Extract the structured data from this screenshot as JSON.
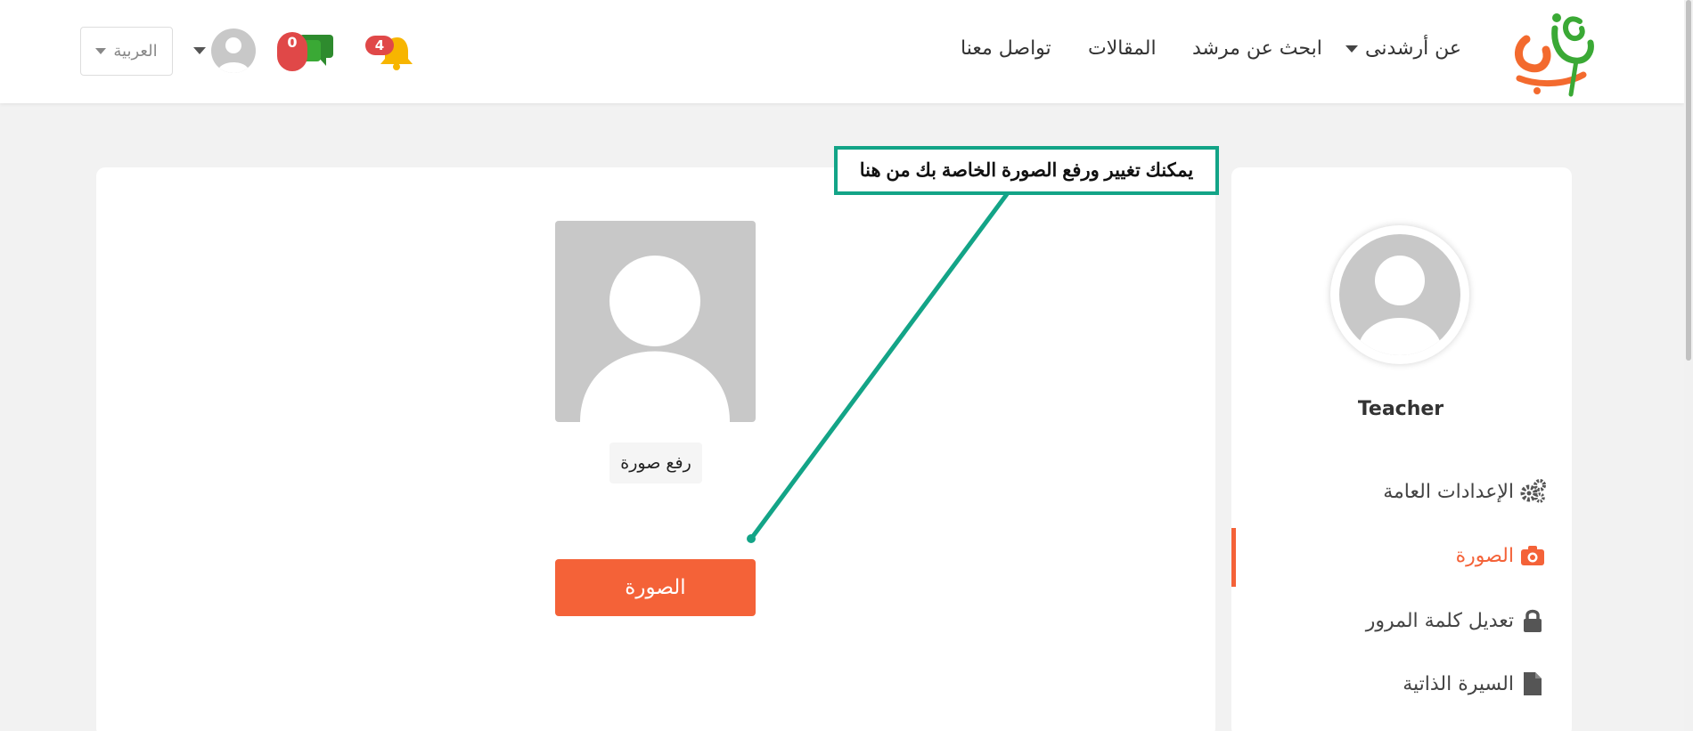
{
  "nav": {
    "links": [
      {
        "label": "عن أرشدنى"
      },
      {
        "label": "ابحث عن مرشد"
      },
      {
        "label": "المقالات"
      },
      {
        "label": "تواصل معنا"
      }
    ],
    "notifications_count": "4",
    "messages_count": "0",
    "language": "العربية"
  },
  "main": {
    "upload_label": "رفع صورة",
    "photo_button_label": "الصورة"
  },
  "profile": {
    "name": "Teacher",
    "menu": [
      {
        "label": "الإعدادات العامة",
        "icon": "gears-icon"
      },
      {
        "label": "الصورة",
        "icon": "camera-icon",
        "active": true
      },
      {
        "label": "تعديل كلمة المرور",
        "icon": "lock-icon"
      },
      {
        "label": "السيرة الذاتية",
        "icon": "file-icon"
      }
    ]
  },
  "annotation": {
    "text": "يمكنك تغيير ورفع الصورة الخاصة بك من هنا"
  },
  "colors": {
    "accent": "#f46238",
    "annotation": "#13a487",
    "logo_orange": "#f36a2e",
    "logo_green": "#3aa935",
    "badge_red": "#e04848"
  }
}
